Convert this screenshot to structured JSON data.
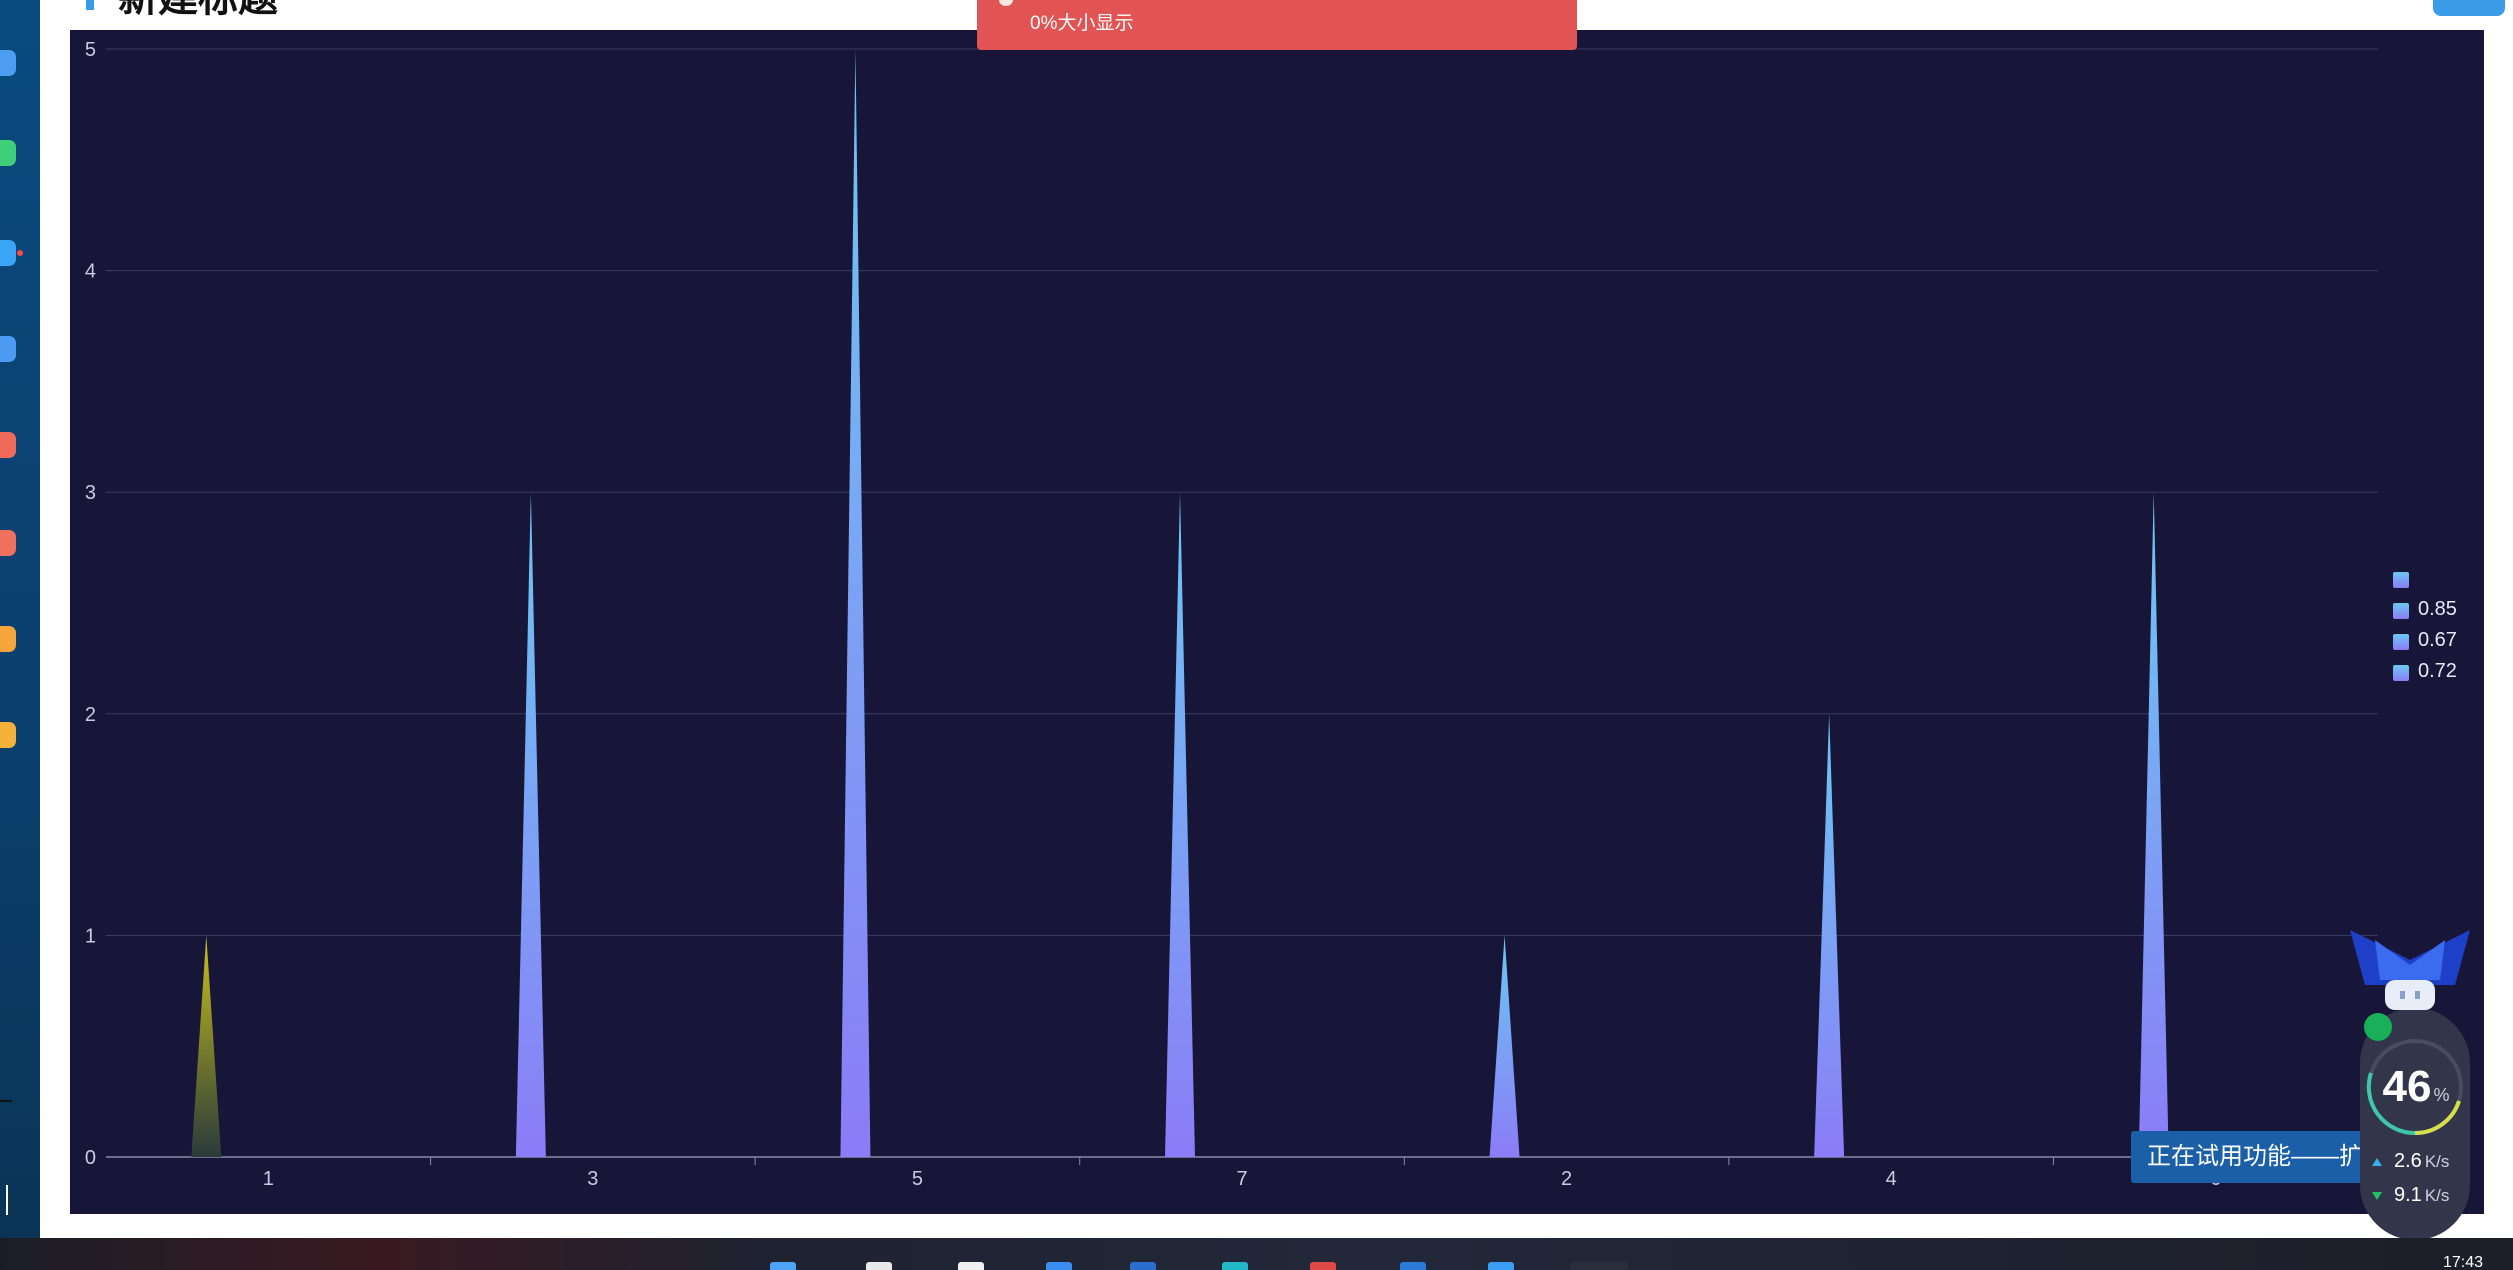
{
  "page": {
    "title": "新建标题"
  },
  "notification": {
    "text": "0%大小显示",
    "color": "#e25353"
  },
  "chart_data": {
    "type": "bar",
    "style": "pictorial-triangle",
    "categories": [
      "1",
      "3",
      "5",
      "7",
      "2",
      "4",
      "6"
    ],
    "values": [
      1,
      3,
      5,
      3,
      1,
      2,
      3
    ],
    "ylim": [
      0,
      5
    ],
    "yticks": [
      "0",
      "1",
      "2",
      "3",
      "4",
      "5"
    ],
    "grid": true,
    "legend": [
      "",
      "0.85",
      "0.67",
      "0.72"
    ],
    "legend_position": "right",
    "colors": {
      "background": "#171538",
      "bar_top": "#6cc8f2",
      "bar_bottom": "#8b7cf7",
      "first_bar_top": "#c9c21c",
      "first_bar_bottom": "#2a3a3a",
      "gridline": "#3b3d63",
      "axis_text": "#c9cbe0"
    }
  },
  "overlay": {
    "trial_banner": "正在试用功能——扩展显示",
    "gauge_value": "46",
    "gauge_unit": "%",
    "upload_speed": "2.6",
    "download_speed": "9.1",
    "speed_unit": "K/s"
  },
  "taskbar": {
    "clock": "17:43"
  }
}
